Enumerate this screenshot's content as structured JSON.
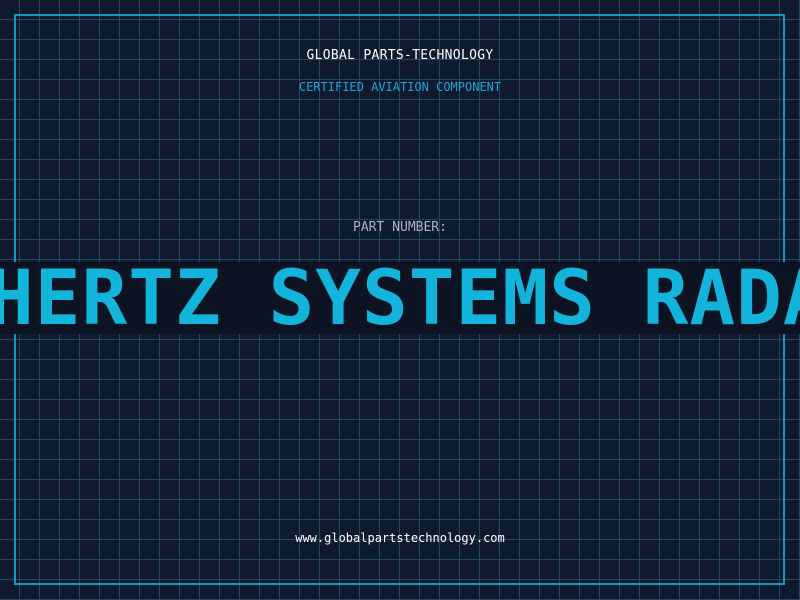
{
  "header": {
    "company_name": "GLOBAL PARTS-TECHNOLOGY",
    "tagline": "CERTIFIED AVIATION COMPONENT"
  },
  "part": {
    "label": "PART NUMBER:",
    "value": "HERTZ SYSTEMS RADAR"
  },
  "footer": {
    "website": "www.globalpartstechnology.com"
  },
  "colors": {
    "background": "#101a2e",
    "grid": "#1f4a5e",
    "frame": "#1596c0",
    "accent": "#12b4dc",
    "banner": "#0c1322"
  }
}
